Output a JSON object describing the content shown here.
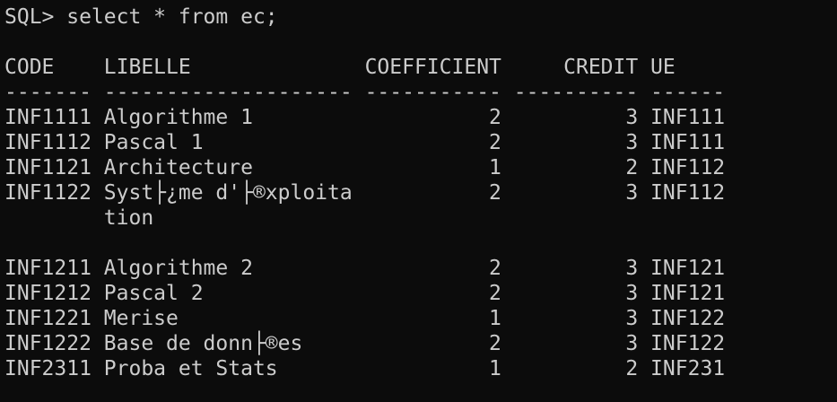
{
  "terminal": {
    "lines": [
      "SQL> select * from ec;",
      "",
      "CODE    LIBELLE              COEFFICIENT     CREDIT UE",
      "------- -------------------- ----------- ---------- ------",
      "INF1111 Algorithme 1                   2          3 INF111",
      "INF1112 Pascal 1                       2          3 INF111",
      "INF1121 Architecture                   1          2 INF112",
      "INF1122 Syst├¿me d'├®xploita           2          3 INF112",
      "        tion",
      "",
      "INF1211 Algorithme 2                   2          3 INF121",
      "INF1212 Pascal 2                       2          3 INF121",
      "INF1221 Merise                         1          3 INF122",
      "INF1222 Base de donn├®es               2          3 INF122",
      "INF2311 Proba et Stats                 1          2 INF231"
    ]
  }
}
